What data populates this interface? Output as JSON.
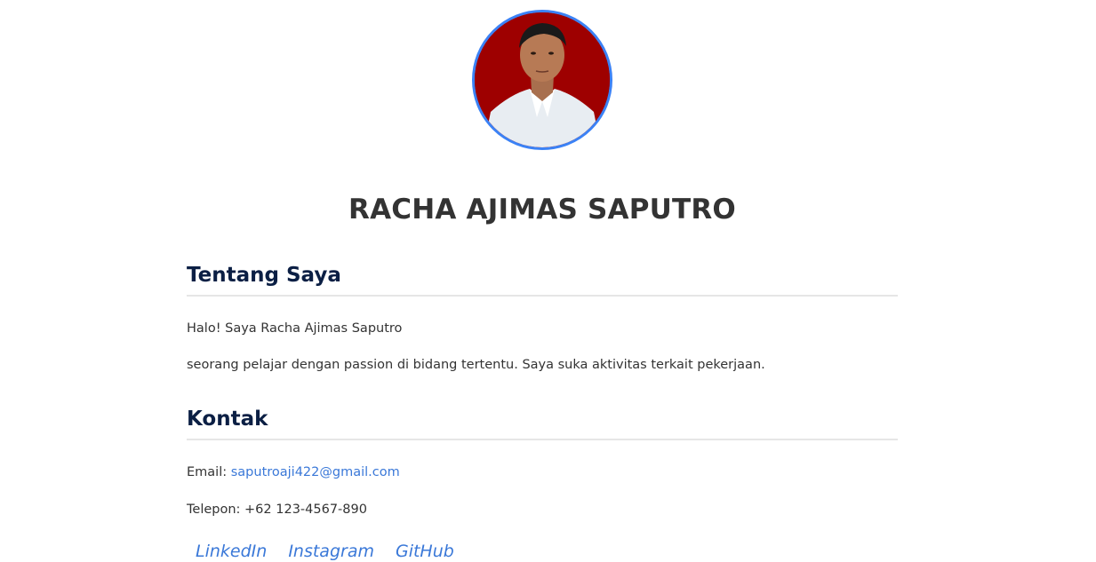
{
  "profile": {
    "name": "RACHA AJIMAS SAPUTRO"
  },
  "about": {
    "title": "Tentang Saya",
    "line1": "Halo! Saya Racha Ajimas Saputro",
    "line2": "seorang pelajar dengan passion di bidang tertentu. Saya suka aktivitas terkait pekerjaan."
  },
  "contact": {
    "title": "Kontak",
    "email_label": "Email: ",
    "email": "saputroaji422@gmail.com",
    "phone_label": "Telepon: ",
    "phone": "+62 123-4567-890"
  },
  "social": {
    "linkedin": "LinkedIn",
    "instagram": "Instagram",
    "github": "GitHub"
  },
  "colors": {
    "accent": "#3b82f6",
    "link": "#3a78d8",
    "heading": "#0b1f44",
    "photo_background": "#9e0000"
  }
}
